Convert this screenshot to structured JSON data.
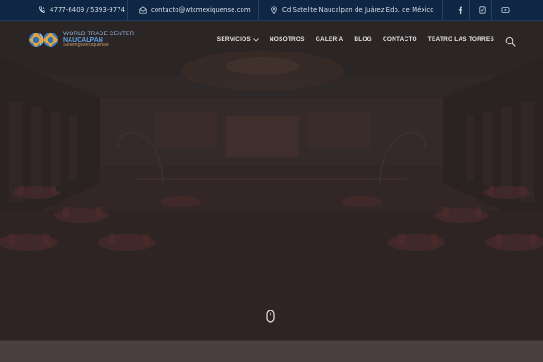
{
  "topbar": {
    "phone": "4777-6409 / 5393-9774",
    "email": "contacto@wtcmexiquense.com",
    "address": "Cd Satelite Naucalpan de Juárez Edo. de México",
    "phone_icon": "phone-icon",
    "email_icon": "envelope-open-icon",
    "address_icon": "map-pin-icon",
    "social": [
      "facebook-icon",
      "instagram-icon",
      "youtube-icon"
    ]
  },
  "logo": {
    "line1": "WORLD TRADE CENTER",
    "line2": "NAUCALPAN",
    "line3": "Serving Mexiquense"
  },
  "nav": {
    "items": [
      {
        "label": "SERVICIOS",
        "has_dropdown": true
      },
      {
        "label": "NOSOTROS"
      },
      {
        "label": "GALERÍA"
      },
      {
        "label": "BLOG"
      },
      {
        "label": "CONTACTO"
      },
      {
        "label": "TEATRO LAS TORRES"
      }
    ],
    "search_icon": "search-icon"
  },
  "hero": {
    "scroll_icon": "mouse-scroll-icon"
  },
  "colors": {
    "topbar_bg": "#0f2744",
    "hero_overlay": "#2b2020",
    "nav_text": "#e4e4e4"
  }
}
